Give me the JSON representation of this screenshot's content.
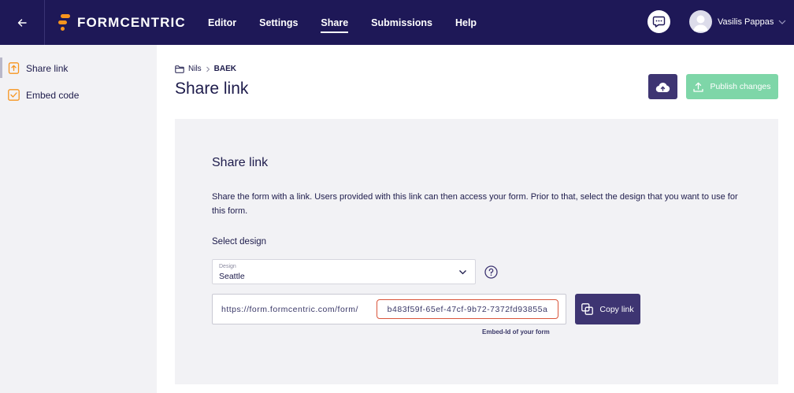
{
  "brand": {
    "name": "FORMCENTRIC",
    "accent": "#f7941d",
    "navy": "#1e1857",
    "primary": "#3e3572",
    "success": "#7ed6a8"
  },
  "topbar": {
    "back_icon": "arrow-left-icon",
    "nav": [
      {
        "label": "Editor",
        "active": false
      },
      {
        "label": "Settings",
        "active": false
      },
      {
        "label": "Share",
        "active": true
      },
      {
        "label": "Submissions",
        "active": false
      },
      {
        "label": "Help",
        "active": false
      }
    ],
    "chat_icon": "chat-bubble-icon",
    "user": {
      "name": "Vasilis Pappas"
    }
  },
  "sidebar": {
    "items": [
      {
        "label": "Share link",
        "icon": "share-upload-icon",
        "active": true
      },
      {
        "label": "Embed code",
        "icon": "embed-check-icon",
        "active": false
      }
    ]
  },
  "breadcrumb": {
    "parent": "Nils",
    "current": "BAEK"
  },
  "page": {
    "title": "Share link"
  },
  "actions": {
    "publish_label": "Publish changes",
    "cloud_icon": "cloud-upload-icon"
  },
  "panel": {
    "title": "Share link",
    "description": "Share the form with a link. Users provided with this link can then access your form. Prior to that, select the design that you want to use for this form.",
    "select_label": "Select design",
    "select": {
      "mini_label": "Design",
      "value": "Seattle"
    },
    "url_prefix": "https://form.formcentric.com/form/",
    "embed_id": "b483f59f-65ef-47cf-9b72-7372fd93855a",
    "embed_caption": "Embed-Id of your form",
    "copy_label": "Copy link"
  }
}
